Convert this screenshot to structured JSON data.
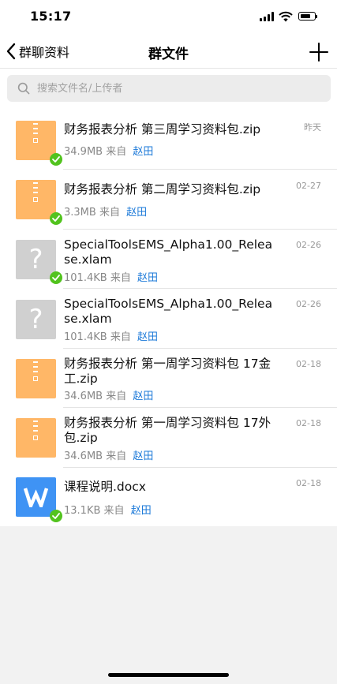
{
  "status_bar": {
    "time": "15:17"
  },
  "nav": {
    "back_label": "群聊资料",
    "title": "群文件"
  },
  "search": {
    "placeholder": "搜索文件名/上传者"
  },
  "files": [
    {
      "name": "财务报表分析 第三周学习资料包.zip",
      "size": "34.9MB",
      "from_label": "来自",
      "uploader": "赵田",
      "date": "昨天",
      "icon": "zip-icon",
      "downloaded": true
    },
    {
      "name": "财务报表分析 第二周学习资料包.zip",
      "size": "3.3MB",
      "from_label": "来自",
      "uploader": "赵田",
      "date": "02-27",
      "icon": "zip-icon",
      "downloaded": true
    },
    {
      "name": "SpecialToolsEMS_Alpha1.00_Release.xlam",
      "size": "101.4KB",
      "from_label": "来自",
      "uploader": "赵田",
      "date": "02-26",
      "icon": "unknown-file-icon",
      "downloaded": true
    },
    {
      "name": "SpecialToolsEMS_Alpha1.00_Release.xlam",
      "size": "101.4KB",
      "from_label": "来自",
      "uploader": "赵田",
      "date": "02-26",
      "icon": "unknown-file-icon",
      "downloaded": false
    },
    {
      "name": "财务报表分析 第一周学习资料包 17金工.zip",
      "size": "34.6MB",
      "from_label": "来自",
      "uploader": "赵田",
      "date": "02-18",
      "icon": "zip-icon",
      "downloaded": false
    },
    {
      "name": "财务报表分析 第一周学习资料包 17外包.zip",
      "size": "34.6MB",
      "from_label": "来自",
      "uploader": "赵田",
      "date": "02-18",
      "icon": "zip-icon",
      "downloaded": false
    },
    {
      "name": "课程说明.docx",
      "size": "13.1KB",
      "from_label": "来自",
      "uploader": "赵田",
      "date": "02-18",
      "icon": "word-doc-icon",
      "downloaded": true
    }
  ],
  "colors": {
    "accent": "#1a78d8",
    "zip": "#ffb767",
    "word": "#3f93f4",
    "unknown": "#d0d0d0",
    "check": "#52c31e"
  }
}
